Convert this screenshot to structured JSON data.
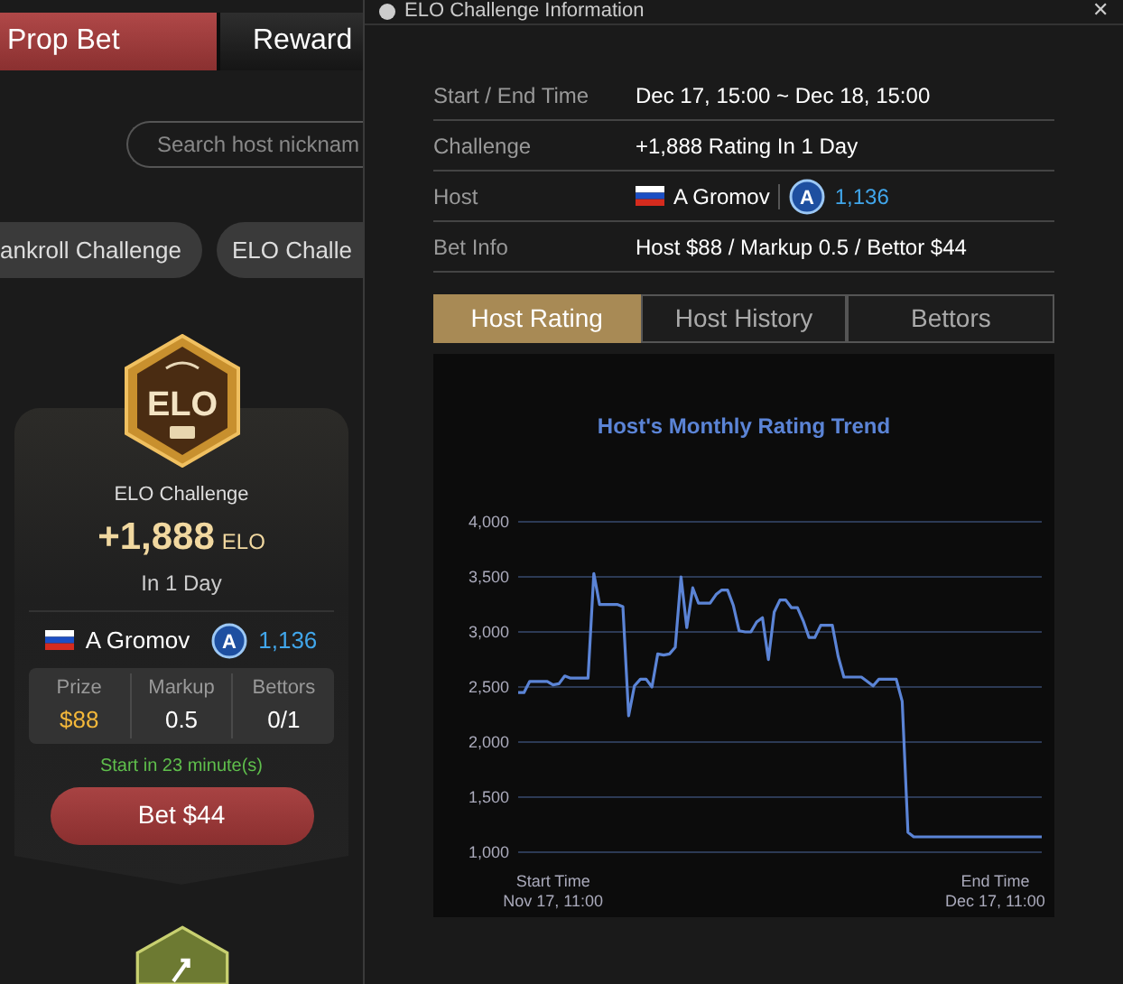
{
  "tabs": [
    {
      "label": "Prop Bet",
      "selected": true
    },
    {
      "label": "Reward",
      "selected": false
    }
  ],
  "search": {
    "placeholder": "Search host nicknam"
  },
  "filters": [
    {
      "label": "ankroll Challenge"
    },
    {
      "label": "ELO Challe"
    }
  ],
  "challenge_card": {
    "badge": "ELO",
    "type": "ELO Challenge",
    "amount": "+1,888",
    "unit": "ELO",
    "duration": "In 1 Day",
    "host": "A Gromov",
    "rank_letter": "A",
    "rating": "1,136",
    "stats": [
      {
        "label": "Prize",
        "value": "$88",
        "kind": "money"
      },
      {
        "label": "Markup",
        "value": "0.5",
        "kind": "plain"
      },
      {
        "label": "Bettors",
        "value": "0/1",
        "kind": "plain"
      }
    ],
    "start_note": "Start in 23 minute(s)",
    "bet_button": "Bet $44"
  },
  "dialog": {
    "title": "ELO Challenge Information",
    "close": "✕",
    "info": [
      {
        "label": "Start / End Time",
        "value": "Dec 17, 15:00 ~ Dec 18, 15:00",
        "kind": "text"
      },
      {
        "label": "Challenge",
        "value": "+1,888 Rating In 1 Day",
        "kind": "text"
      },
      {
        "label": "Host",
        "value": "A Gromov",
        "kind": "host",
        "rank_letter": "A",
        "rating": "1,136"
      },
      {
        "label": "Bet Info",
        "value": "Host $88 / Markup 0.5 / Bettor $44",
        "kind": "text"
      }
    ],
    "tabs": [
      {
        "label": "Host Rating",
        "selected": true
      },
      {
        "label": "Host History",
        "selected": false
      },
      {
        "label": "Bettors",
        "selected": false
      }
    ],
    "chart_data": {
      "type": "line",
      "grid": true,
      "title": "Host's Monthly Rating Trend",
      "ylim": [
        1000,
        4000
      ],
      "yticks": [
        {
          "value": 1000,
          "label": "1,000"
        },
        {
          "value": 1500,
          "label": "1,500"
        },
        {
          "value": 2000,
          "label": "2,000"
        },
        {
          "value": 2500,
          "label": "2,500"
        },
        {
          "value": 3000,
          "label": "3,000"
        },
        {
          "value": 3500,
          "label": "3,500"
        },
        {
          "value": 4000,
          "label": "4,000"
        }
      ],
      "categories": [
        null,
        null,
        null,
        null,
        null,
        null,
        "Start Time\nNov 17, 11:00",
        null,
        null,
        null,
        null,
        null,
        null,
        null,
        null,
        null,
        null,
        null,
        null,
        null,
        null,
        null,
        null,
        null,
        null,
        null,
        null,
        null,
        null,
        null,
        null,
        null,
        null,
        null,
        null,
        null,
        null,
        null,
        null,
        null,
        null,
        null,
        null,
        null,
        null,
        null,
        null,
        null,
        null,
        null,
        null,
        null,
        null,
        null,
        null,
        null,
        null,
        null,
        null,
        null,
        null,
        null,
        null,
        null,
        null,
        null,
        null,
        null,
        null,
        null,
        null,
        null,
        null,
        null,
        null,
        null,
        null,
        null,
        null,
        null,
        null,
        null,
        "End Time\nDec 17, 11:00",
        null,
        null,
        null,
        null,
        null,
        null,
        null,
        null
      ],
      "series": [
        {
          "color": "#5b84d6",
          "values": [
            2450,
            2450,
            2550,
            2550,
            2550,
            2550,
            2520,
            2530,
            2600,
            2580,
            2580,
            2580,
            2580,
            3530,
            3250,
            3250,
            3250,
            3250,
            3230,
            2240,
            2510,
            2570,
            2570,
            2500,
            2800,
            2790,
            2800,
            2860,
            3500,
            3040,
            3400,
            3260,
            3260,
            3260,
            3340,
            3380,
            3380,
            3240,
            3010,
            3000,
            3000,
            3090,
            3130,
            2750,
            3180,
            3290,
            3290,
            3220,
            3220,
            3100,
            2950,
            2950,
            3060,
            3060,
            3060,
            2780,
            2590,
            2590,
            2590,
            2590,
            2550,
            2510,
            2570,
            2570,
            2570,
            2570,
            2370,
            1180,
            1140,
            1140,
            1140,
            1140,
            1140,
            1140,
            1140,
            1140,
            1140,
            1140,
            1140,
            1140,
            1140,
            1140,
            1140,
            1140,
            1140,
            1140,
            1140,
            1140,
            1140,
            1140,
            1140
          ]
        }
      ]
    }
  }
}
